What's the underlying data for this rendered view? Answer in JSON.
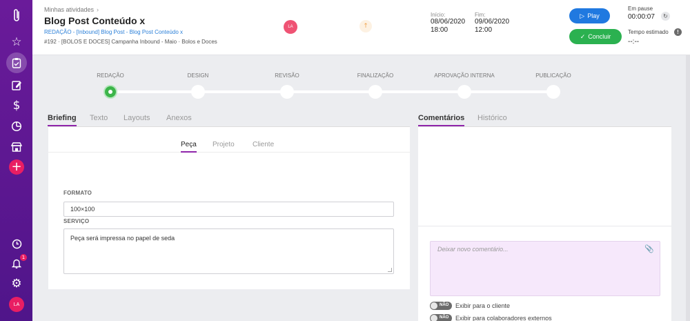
{
  "sidebar": {
    "items": [
      {
        "icon": "paperclip-logo-icon"
      },
      {
        "icon": "star-icon"
      },
      {
        "icon": "clipboard-icon"
      },
      {
        "icon": "edit-icon"
      },
      {
        "icon": "dollar-icon"
      },
      {
        "icon": "pie-chart-icon"
      },
      {
        "icon": "store-icon"
      },
      {
        "icon": "add-icon"
      },
      {
        "icon": "clock-icon"
      },
      {
        "icon": "bell-icon"
      },
      {
        "icon": "gear-icon"
      }
    ],
    "notification_count": "1",
    "avatar_initials": "LA"
  },
  "header": {
    "breadcrumb": "Minhas atividades",
    "title": "Blog Post Conteúdo x",
    "subtitle": "REDAÇÃO - [Inbound] Blog Post - Blog Post Conteúdo x",
    "reference": "#192 · [BOLOS E DOCES] Campanha Inbound - Maio · Bolos e Doces",
    "assignee_initials": "LA",
    "start_label": "Início:",
    "start_date": "08/06/2020",
    "start_time": "18:00",
    "end_label": "Fim:",
    "end_date": "09/06/2020",
    "end_time": "12:00",
    "play_label": "Play",
    "done_label": "Concluir",
    "pause_label": "Em pause",
    "pause_time": "00:00:07",
    "estimate_label": "Tempo estimado",
    "estimate_value": "--:--"
  },
  "stepper": {
    "steps": [
      "REDAÇÃO",
      "DESIGN",
      "REVISÃO",
      "FINALIZAÇÃO",
      "APROVAÇÃO INTERNA",
      "PUBLICAÇÃO"
    ],
    "current_index": 0
  },
  "left_tabs": [
    "Briefing",
    "Texto",
    "Layouts",
    "Anexos"
  ],
  "right_tabs": [
    "Comentários",
    "Histórico"
  ],
  "subtabs": [
    "Peça",
    "Projeto",
    "Cliente"
  ],
  "form": {
    "format_label": "FORMATO",
    "format_value": "100×100",
    "service_label": "SERVIÇO",
    "service_value": "Peça será impressa no papel de seda"
  },
  "comments": {
    "placeholder": "Deixar novo comentário...",
    "toggle_off_text": "NÃO",
    "show_client_label": "Exibir para o cliente",
    "show_external_label": "Exibir para colaboradores externos"
  },
  "colors": {
    "sidebar": "#5b1790",
    "accent": "#8e24aa",
    "play": "#2079e0",
    "done": "#2bb150",
    "current_step": "#3cb54a"
  }
}
